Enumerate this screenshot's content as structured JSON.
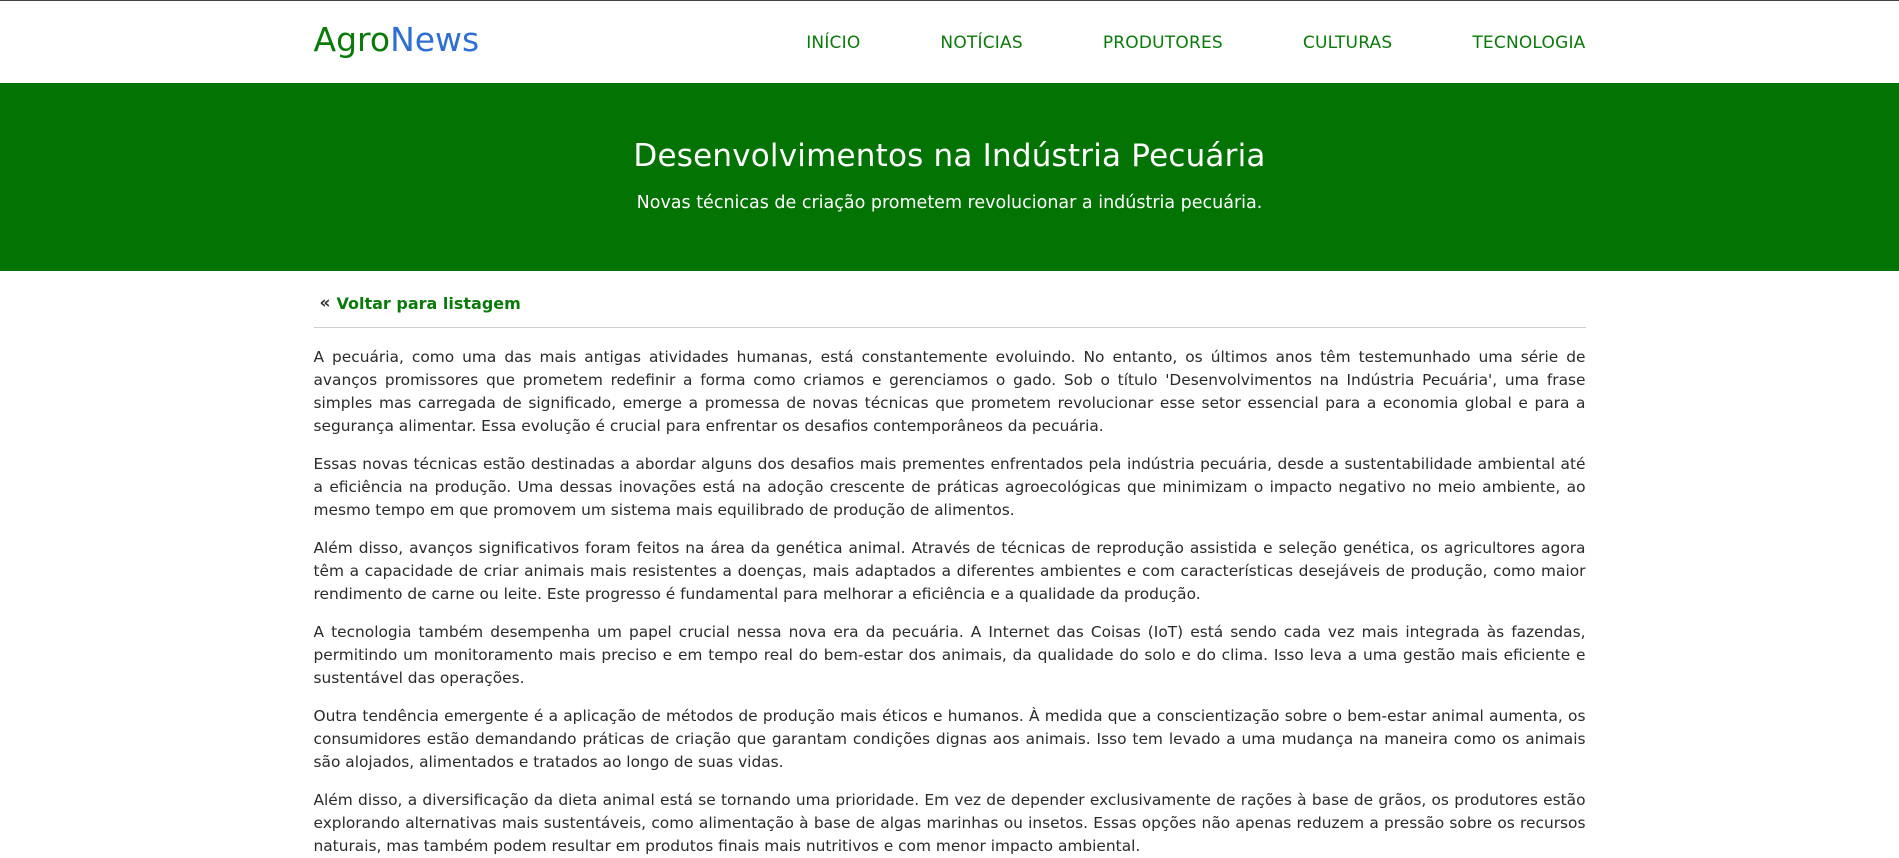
{
  "brand": {
    "part1": "Agro",
    "part2": "News",
    "colors": {
      "agro": "#0a7a0a",
      "news": "#2f6fd1"
    }
  },
  "nav": {
    "items": [
      {
        "label": "INÍCIO"
      },
      {
        "label": "NOTÍCIAS"
      },
      {
        "label": "PRODUTORES"
      },
      {
        "label": "CULTURAS"
      },
      {
        "label": "TECNOLOGIA"
      }
    ]
  },
  "hero": {
    "title": "Desenvolvimentos na Indústria Pecuária",
    "subtitle": "Novas técnicas de criação prometem revolucionar a indústria pecuária.",
    "background": "#037303"
  },
  "back_link": {
    "icon": "«",
    "label": "Voltar para listagem"
  },
  "article": {
    "paragraphs": [
      "A pecuária, como uma das mais antigas atividades humanas, está constantemente evoluindo. No entanto, os últimos anos têm testemunhado uma série de avanços promissores que prometem redefinir a forma como criamos e gerenciamos o gado. Sob o título 'Desenvolvimentos na Indústria Pecuária', uma frase simples mas carregada de significado, emerge a promessa de novas técnicas que prometem revolucionar esse setor essencial para a economia global e para a segurança alimentar. Essa evolução é crucial para enfrentar os desafios contemporâneos da pecuária.",
      "Essas novas técnicas estão destinadas a abordar alguns dos desafios mais prementes enfrentados pela indústria pecuária, desde a sustentabilidade ambiental até a eficiência na produção. Uma dessas inovações está na adoção crescente de práticas agroecológicas que minimizam o impacto negativo no meio ambiente, ao mesmo tempo em que promovem um sistema mais equilibrado de produção de alimentos.",
      "Além disso, avanços significativos foram feitos na área da genética animal. Através de técnicas de reprodução assistida e seleção genética, os agricultores agora têm a capacidade de criar animais mais resistentes a doenças, mais adaptados a diferentes ambientes e com características desejáveis de produção, como maior rendimento de carne ou leite. Este progresso é fundamental para melhorar a eficiência e a qualidade da produção.",
      "A tecnologia também desempenha um papel crucial nessa nova era da pecuária. A Internet das Coisas (IoT) está sendo cada vez mais integrada às fazendas, permitindo um monitoramento mais preciso e em tempo real do bem-estar dos animais, da qualidade do solo e do clima. Isso leva a uma gestão mais eficiente e sustentável das operações.",
      "Outra tendência emergente é a aplicação de métodos de produção mais éticos e humanos. À medida que a conscientização sobre o bem-estar animal aumenta, os consumidores estão demandando práticas de criação que garantam condições dignas aos animais. Isso tem levado a uma mudança na maneira como os animais são alojados, alimentados e tratados ao longo de suas vidas.",
      "Além disso, a diversificação da dieta animal está se tornando uma prioridade. Em vez de depender exclusivamente de rações à base de grãos, os produtores estão explorando alternativas mais sustentáveis, como alimentação à base de algas marinhas ou insetos. Essas opções não apenas reduzem a pressão sobre os recursos naturais, mas também podem resultar em produtos finais mais nutritivos e com menor impacto ambiental."
    ]
  }
}
